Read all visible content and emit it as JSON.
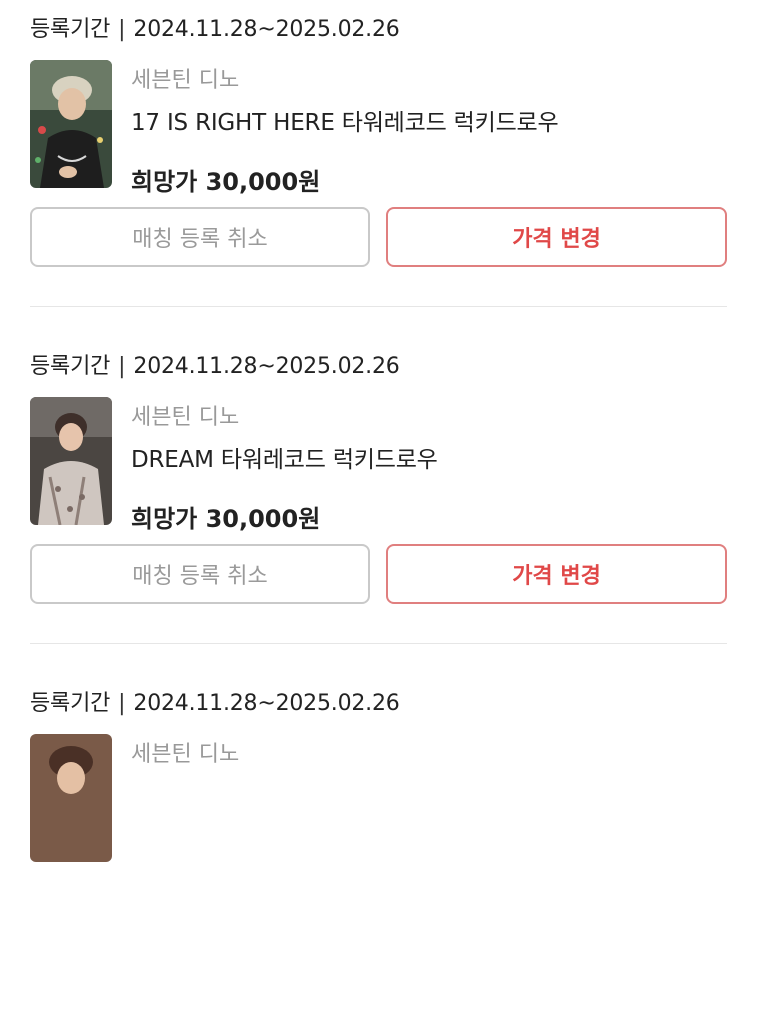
{
  "items": [
    {
      "period_label": "등록기간",
      "period_range": "2024.11.28~2025.02.26",
      "artist": "세븐틴 디노",
      "title": "17 IS RIGHT HERE 타워레코드 럭키드로우",
      "price": "희망가 30,000원",
      "cancel_label": "매칭 등록 취소",
      "change_label": "가격 변경"
    },
    {
      "period_label": "등록기간",
      "period_range": "2024.11.28~2025.02.26",
      "artist": "세븐틴 디노",
      "title": "DREAM 타워레코드 럭키드로우",
      "price": "희망가 30,000원",
      "cancel_label": "매칭 등록 취소",
      "change_label": "가격 변경"
    },
    {
      "period_label": "등록기간",
      "period_range": "2024.11.28~2025.02.26",
      "artist": "세븐틴 디노"
    }
  ]
}
